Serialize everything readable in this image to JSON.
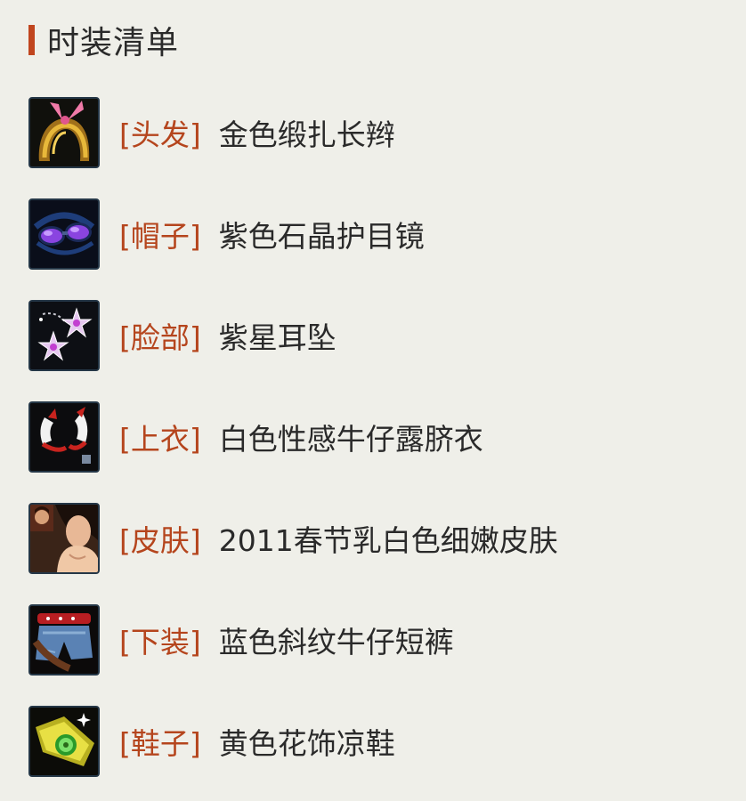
{
  "header": {
    "title": "时装清单",
    "accent_color": "#c0451e"
  },
  "items": [
    {
      "category": "[头发]",
      "name": "金色缎扎长辫",
      "icon": "golden-braid-hair-icon"
    },
    {
      "category": "[帽子]",
      "name": "紫色石晶护目镜",
      "icon": "purple-goggles-icon"
    },
    {
      "category": "[脸部]",
      "name": "紫星耳坠",
      "icon": "purple-star-earrings-icon"
    },
    {
      "category": "[上衣]",
      "name": "白色性感牛仔露脐衣",
      "icon": "white-crop-top-icon"
    },
    {
      "category": "[皮肤]",
      "name": "2011春节乳白色细嫩皮肤",
      "icon": "skin-portrait-icon"
    },
    {
      "category": "[下装]",
      "name": "蓝色斜纹牛仔短裤",
      "icon": "denim-shorts-icon"
    },
    {
      "category": "[鞋子]",
      "name": "黄色花饰凉鞋",
      "icon": "yellow-flower-sandals-icon"
    }
  ],
  "colors": {
    "category": "#b5451d",
    "text": "#2a2a2a",
    "background": "#efefe9"
  }
}
